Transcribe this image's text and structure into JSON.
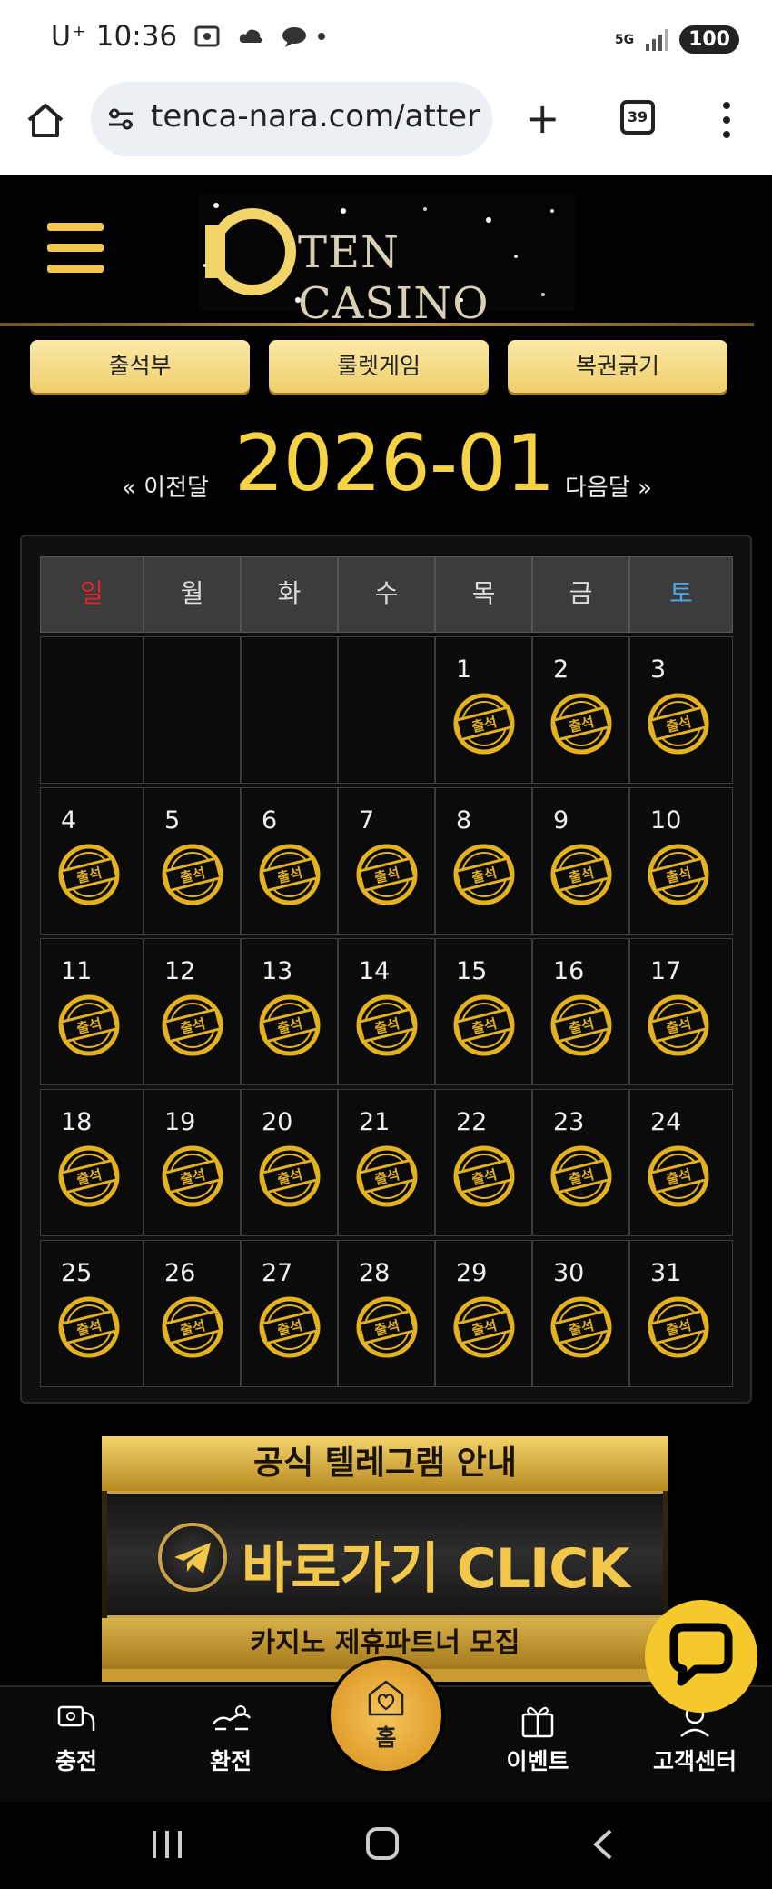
{
  "status_bar": {
    "carrier": "U⁺",
    "time": "10:36",
    "network": "5G",
    "battery": "100"
  },
  "browser": {
    "url": "tenca-nara.com/atter",
    "tab_count": "39"
  },
  "header": {
    "logo_text": "TEN CASINO"
  },
  "nav_buttons": [
    "출석부",
    "룰렛게임",
    "복권긁기"
  ],
  "month_nav": {
    "prev": "« 이전달",
    "title": "2026-01",
    "next": "다음달 »"
  },
  "calendar": {
    "weekdays": [
      "일",
      "월",
      "화",
      "수",
      "목",
      "금",
      "토"
    ],
    "weekday_colors": [
      "#e0242c",
      "#dddddd",
      "#dddddd",
      "#dddddd",
      "#dddddd",
      "#dddddd",
      "#4aa8e8"
    ],
    "first_weekday_index": 4,
    "days_in_month": 31,
    "attended_days": [
      1,
      2,
      3,
      4,
      5,
      6,
      7,
      8,
      9,
      10,
      11,
      12,
      13,
      14,
      15,
      16,
      17,
      18,
      19,
      20,
      21,
      22,
      23,
      24,
      25,
      26,
      27,
      28,
      29,
      30,
      31
    ],
    "stamp_label": "출석"
  },
  "banner": {
    "top_text": "공식 텔레그램 안내",
    "cta_text": "바로가기 CLICK",
    "sub_text": "카지노 제휴파트너 모집"
  },
  "bottom_nav": {
    "items": [
      {
        "label": "충전",
        "icon": "charge-icon"
      },
      {
        "label": "환전",
        "icon": "exchange-icon"
      },
      {
        "label": "홈",
        "icon": "home-heart-icon"
      },
      {
        "label": "이벤트",
        "icon": "gift-icon"
      },
      {
        "label": "고객센터",
        "icon": "support-icon"
      }
    ]
  },
  "colors": {
    "accent_gold": "#f2c74a",
    "title_gold": "#f6d343",
    "sunday_red": "#e0242c",
    "saturday_blue": "#4aa8e8"
  }
}
